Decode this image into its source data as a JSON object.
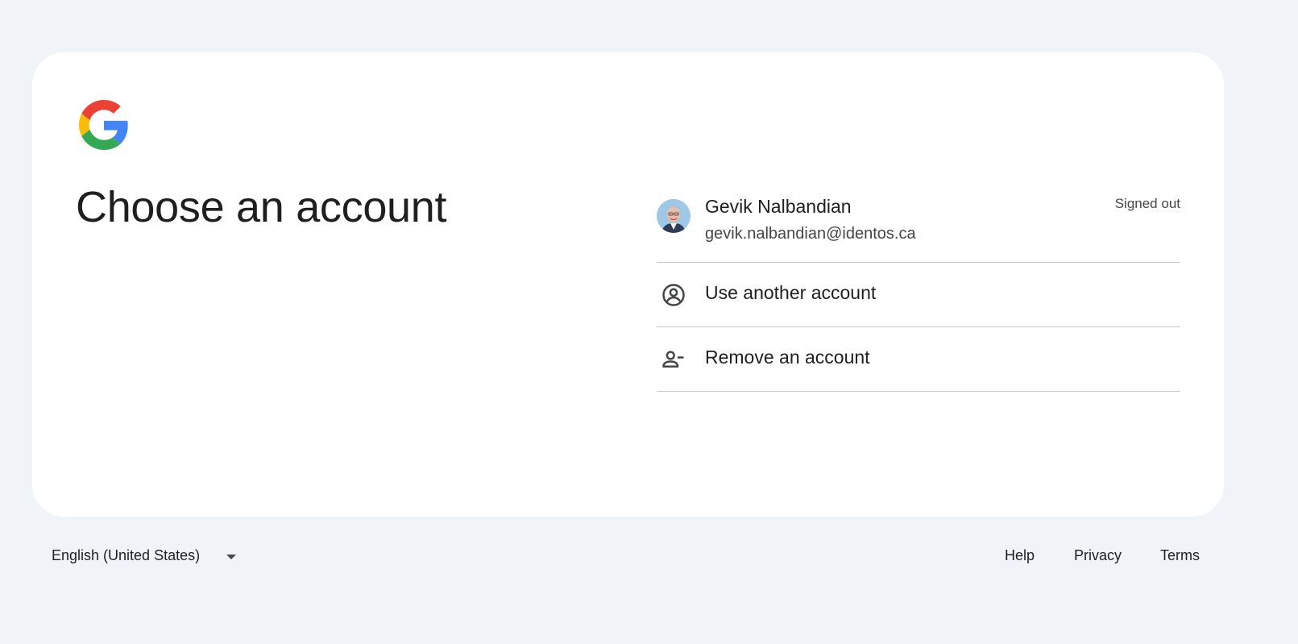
{
  "brand": {
    "logo_icon": "google-g-logo",
    "colors": {
      "blue": "#4285F4",
      "red": "#EA4335",
      "yellow": "#FBBC05",
      "green": "#34A853"
    }
  },
  "main": {
    "title": "Choose an account"
  },
  "accounts": [
    {
      "name": "Gevik Nalbandian",
      "email": "gevik.nalbandian@identos.ca",
      "status": "Signed out"
    }
  ],
  "actions": {
    "use_another": {
      "label": "Use another account",
      "icon": "account-circle-icon"
    },
    "remove": {
      "label": "Remove an account",
      "icon": "person-remove-icon"
    }
  },
  "footer": {
    "language": "English (United States)",
    "links": {
      "help": "Help",
      "privacy": "Privacy",
      "terms": "Terms"
    }
  }
}
